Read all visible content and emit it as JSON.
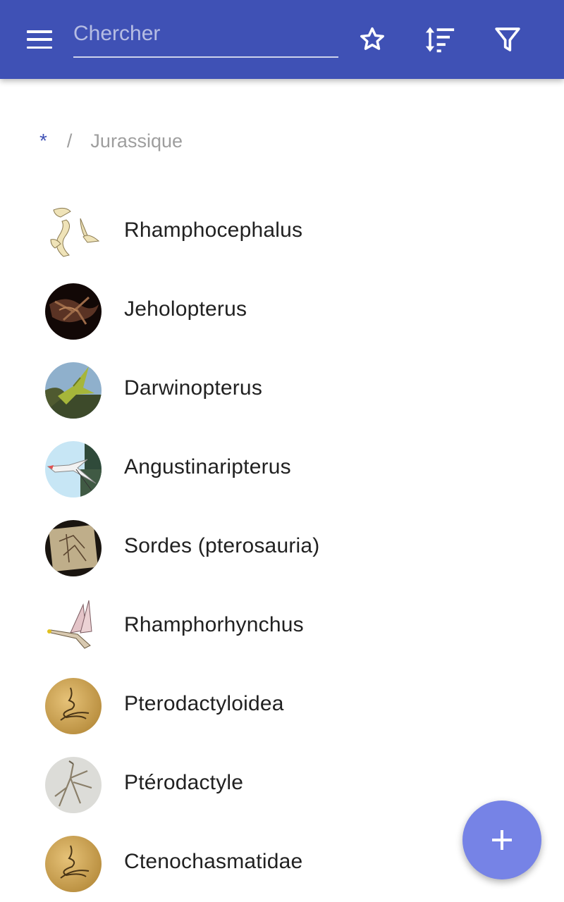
{
  "appbar": {
    "search": {
      "placeholder": "Chercher",
      "value": ""
    },
    "icons": {
      "menu": "menu-icon",
      "favorites": "star-outline-icon",
      "sort": "sort-icon",
      "filter": "filter-icon"
    },
    "color": "#3f51b5"
  },
  "breadcrumb": {
    "root": "*",
    "separator": "/",
    "current": "Jurassique"
  },
  "items": [
    {
      "label": "Rhamphocephalus"
    },
    {
      "label": "Jeholopterus"
    },
    {
      "label": "Darwinopterus"
    },
    {
      "label": "Angustinaripterus"
    },
    {
      "label": "Sordes (pterosauria)"
    },
    {
      "label": "Rhamphorhynchus"
    },
    {
      "label": "Pterodactyloidea"
    },
    {
      "label": "Ptérodactyle"
    },
    {
      "label": "Ctenochasmatidae"
    }
  ],
  "fab": {
    "icon": "plus-icon",
    "color": "#7683e6"
  }
}
